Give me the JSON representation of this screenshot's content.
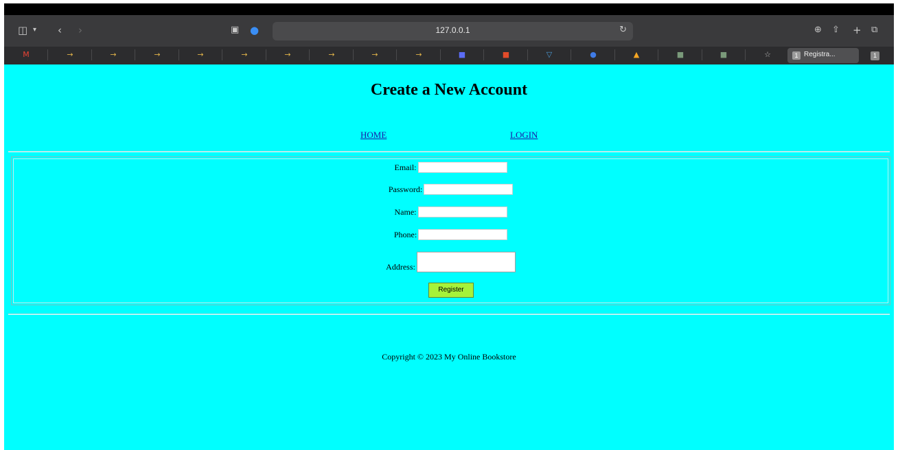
{
  "browser": {
    "url": "127.0.0.1",
    "active_tab_title": "Registra...",
    "active_tab_badge": "1",
    "tab_count": "1"
  },
  "bookmarks": [
    {
      "icon": "gmail-icon",
      "glyph": "M",
      "color": "#ea4335"
    },
    {
      "icon": "arrow-icon",
      "glyph": "→",
      "color": "#e0b34a"
    },
    {
      "icon": "arrow-icon",
      "glyph": "→",
      "color": "#e0b34a"
    },
    {
      "icon": "arrow-icon",
      "glyph": "→",
      "color": "#e0b34a"
    },
    {
      "icon": "arrow-icon",
      "glyph": "→",
      "color": "#e0b34a"
    },
    {
      "icon": "arrow-icon",
      "glyph": "→",
      "color": "#e0b34a"
    },
    {
      "icon": "arrow-icon",
      "glyph": "→",
      "color": "#e0b34a"
    },
    {
      "icon": "arrow-icon",
      "glyph": "→",
      "color": "#e0b34a"
    },
    {
      "icon": "arrow-icon",
      "glyph": "→",
      "color": "#e0b34a"
    },
    {
      "icon": "arrow-icon",
      "glyph": "→",
      "color": "#e0b34a"
    },
    {
      "icon": "app-icon",
      "glyph": "■",
      "color": "#5b6cf5"
    },
    {
      "icon": "app-icon",
      "glyph": "■",
      "color": "#e24b2a"
    },
    {
      "icon": "vue-icon",
      "glyph": "▽",
      "color": "#4a9ad6"
    },
    {
      "icon": "app-icon",
      "glyph": "●",
      "color": "#3f7be6"
    },
    {
      "icon": "firebase-icon",
      "glyph": "▲",
      "color": "#f5a623"
    },
    {
      "icon": "gfg-icon",
      "glyph": "■",
      "color": "#7a9a7a"
    },
    {
      "icon": "gfg-icon",
      "glyph": "■",
      "color": "#7a9a7a"
    },
    {
      "icon": "star-icon",
      "glyph": "☆",
      "color": "#bdbdbd"
    }
  ],
  "page": {
    "title": "Create a New Account",
    "nav": {
      "home": "HOME",
      "login": "LOGIN"
    },
    "form": {
      "email_label": "Email:",
      "password_label": "Password:",
      "name_label": "Name:",
      "phone_label": "Phone:",
      "address_label": "Address:",
      "email_value": "",
      "password_value": "",
      "name_value": "",
      "phone_value": "",
      "address_value": "",
      "register_label": "Register"
    },
    "footer": "Copyright © 2023 My Online Bookstore"
  },
  "colors": {
    "page_background": "#00ffff",
    "button_background": "#a6f23a",
    "link": "#1a1aa6"
  }
}
